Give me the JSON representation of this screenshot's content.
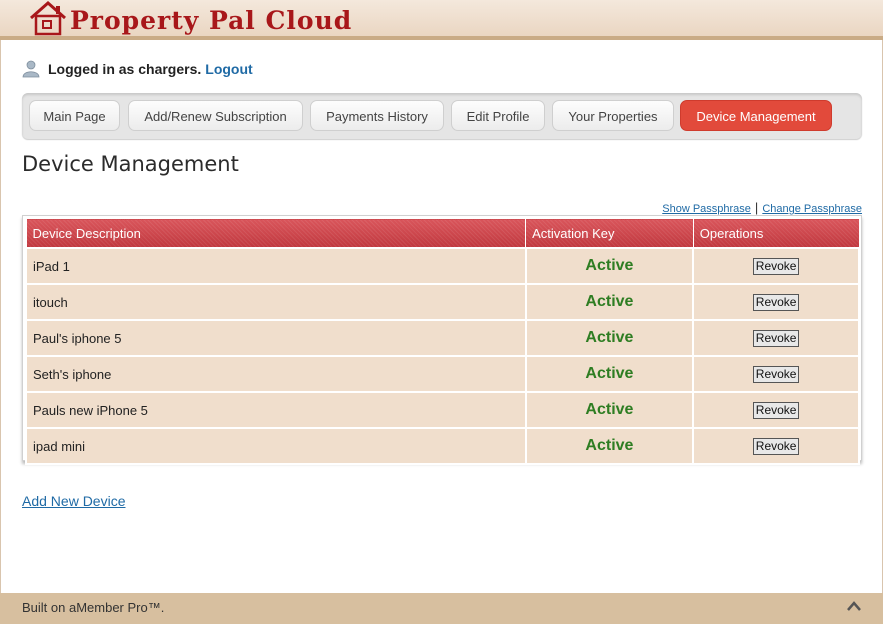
{
  "brand": {
    "name": "Property Pal Cloud"
  },
  "user": {
    "logged_in_text": "Logged in as chargers.",
    "logout_label": "Logout"
  },
  "tabs": [
    {
      "label": "Main Page",
      "active": false
    },
    {
      "label": "Add/Renew Subscription",
      "active": false
    },
    {
      "label": "Payments History",
      "active": false
    },
    {
      "label": "Edit Profile",
      "active": false
    },
    {
      "label": "Your Properties",
      "active": false
    },
    {
      "label": "Device Management",
      "active": true
    }
  ],
  "page": {
    "title": "Device Management"
  },
  "passphrase": {
    "show_label": "Show Passphrase",
    "separator": "|",
    "change_label": "Change Passphrase"
  },
  "table": {
    "columns": [
      "Device Description",
      "Activation Key",
      "Operations"
    ],
    "rows": [
      {
        "description": "iPad 1",
        "status": "Active",
        "action": "Revoke"
      },
      {
        "description": "itouch",
        "status": "Active",
        "action": "Revoke"
      },
      {
        "description": "Paul's iphone 5",
        "status": "Active",
        "action": "Revoke"
      },
      {
        "description": "Seth's iphone",
        "status": "Active",
        "action": "Revoke"
      },
      {
        "description": "Pauls new iPhone 5",
        "status": "Active",
        "action": "Revoke"
      },
      {
        "description": "ipad mini",
        "status": "Active",
        "action": "Revoke"
      }
    ]
  },
  "add_device_label": "Add New Device",
  "footer": {
    "built_text": "Built on aMember Pro™."
  },
  "colors": {
    "brand": "#a8171a",
    "active_tab": "#e24a3b",
    "status_active": "#2e7d22",
    "table_header": "#c9444a",
    "row_bg": "#f0decc"
  }
}
